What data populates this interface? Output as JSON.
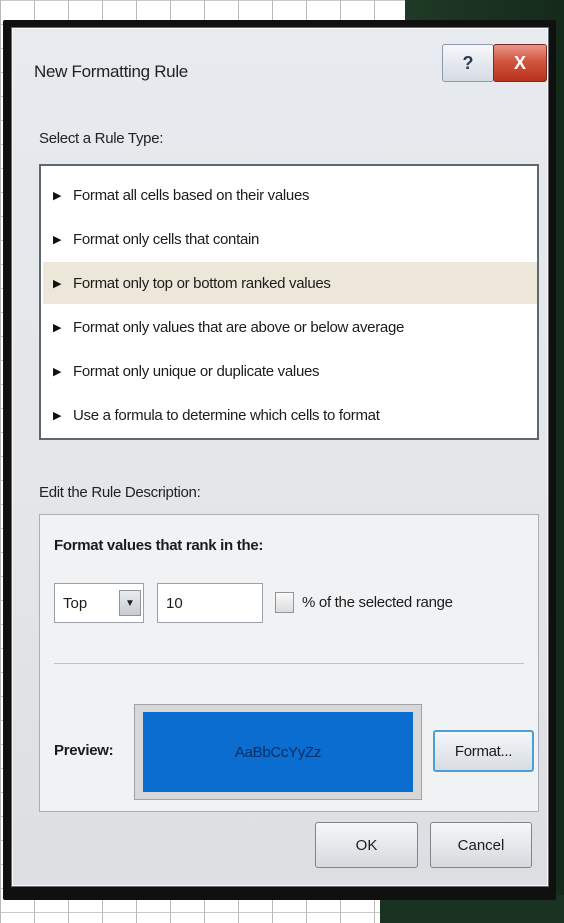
{
  "dialog": {
    "title": "New Formatting Rule",
    "help_label": "?",
    "close_label": "X"
  },
  "rule_type": {
    "label": "Select a Rule Type:",
    "items": [
      {
        "label": "Format all cells based on their values",
        "selected": false
      },
      {
        "label": "Format only cells that contain",
        "selected": false
      },
      {
        "label": "Format only top or bottom ranked values",
        "selected": true
      },
      {
        "label": "Format only values that are above or below average",
        "selected": false
      },
      {
        "label": "Format only unique or duplicate values",
        "selected": false
      },
      {
        "label": "Use a formula to determine which cells to format",
        "selected": false
      }
    ]
  },
  "description": {
    "label": "Edit the Rule Description:",
    "heading": "Format values that rank in the:",
    "rank_select": "Top",
    "rank_value": "10",
    "percent_checkbox_label": "% of the selected range",
    "percent_checked": false,
    "preview_label": "Preview:",
    "preview_text": "AaBbCcYyZz",
    "preview_fill_color": "#0a6dcf",
    "format_button": "Format..."
  },
  "buttons": {
    "ok": "OK",
    "cancel": "Cancel"
  }
}
